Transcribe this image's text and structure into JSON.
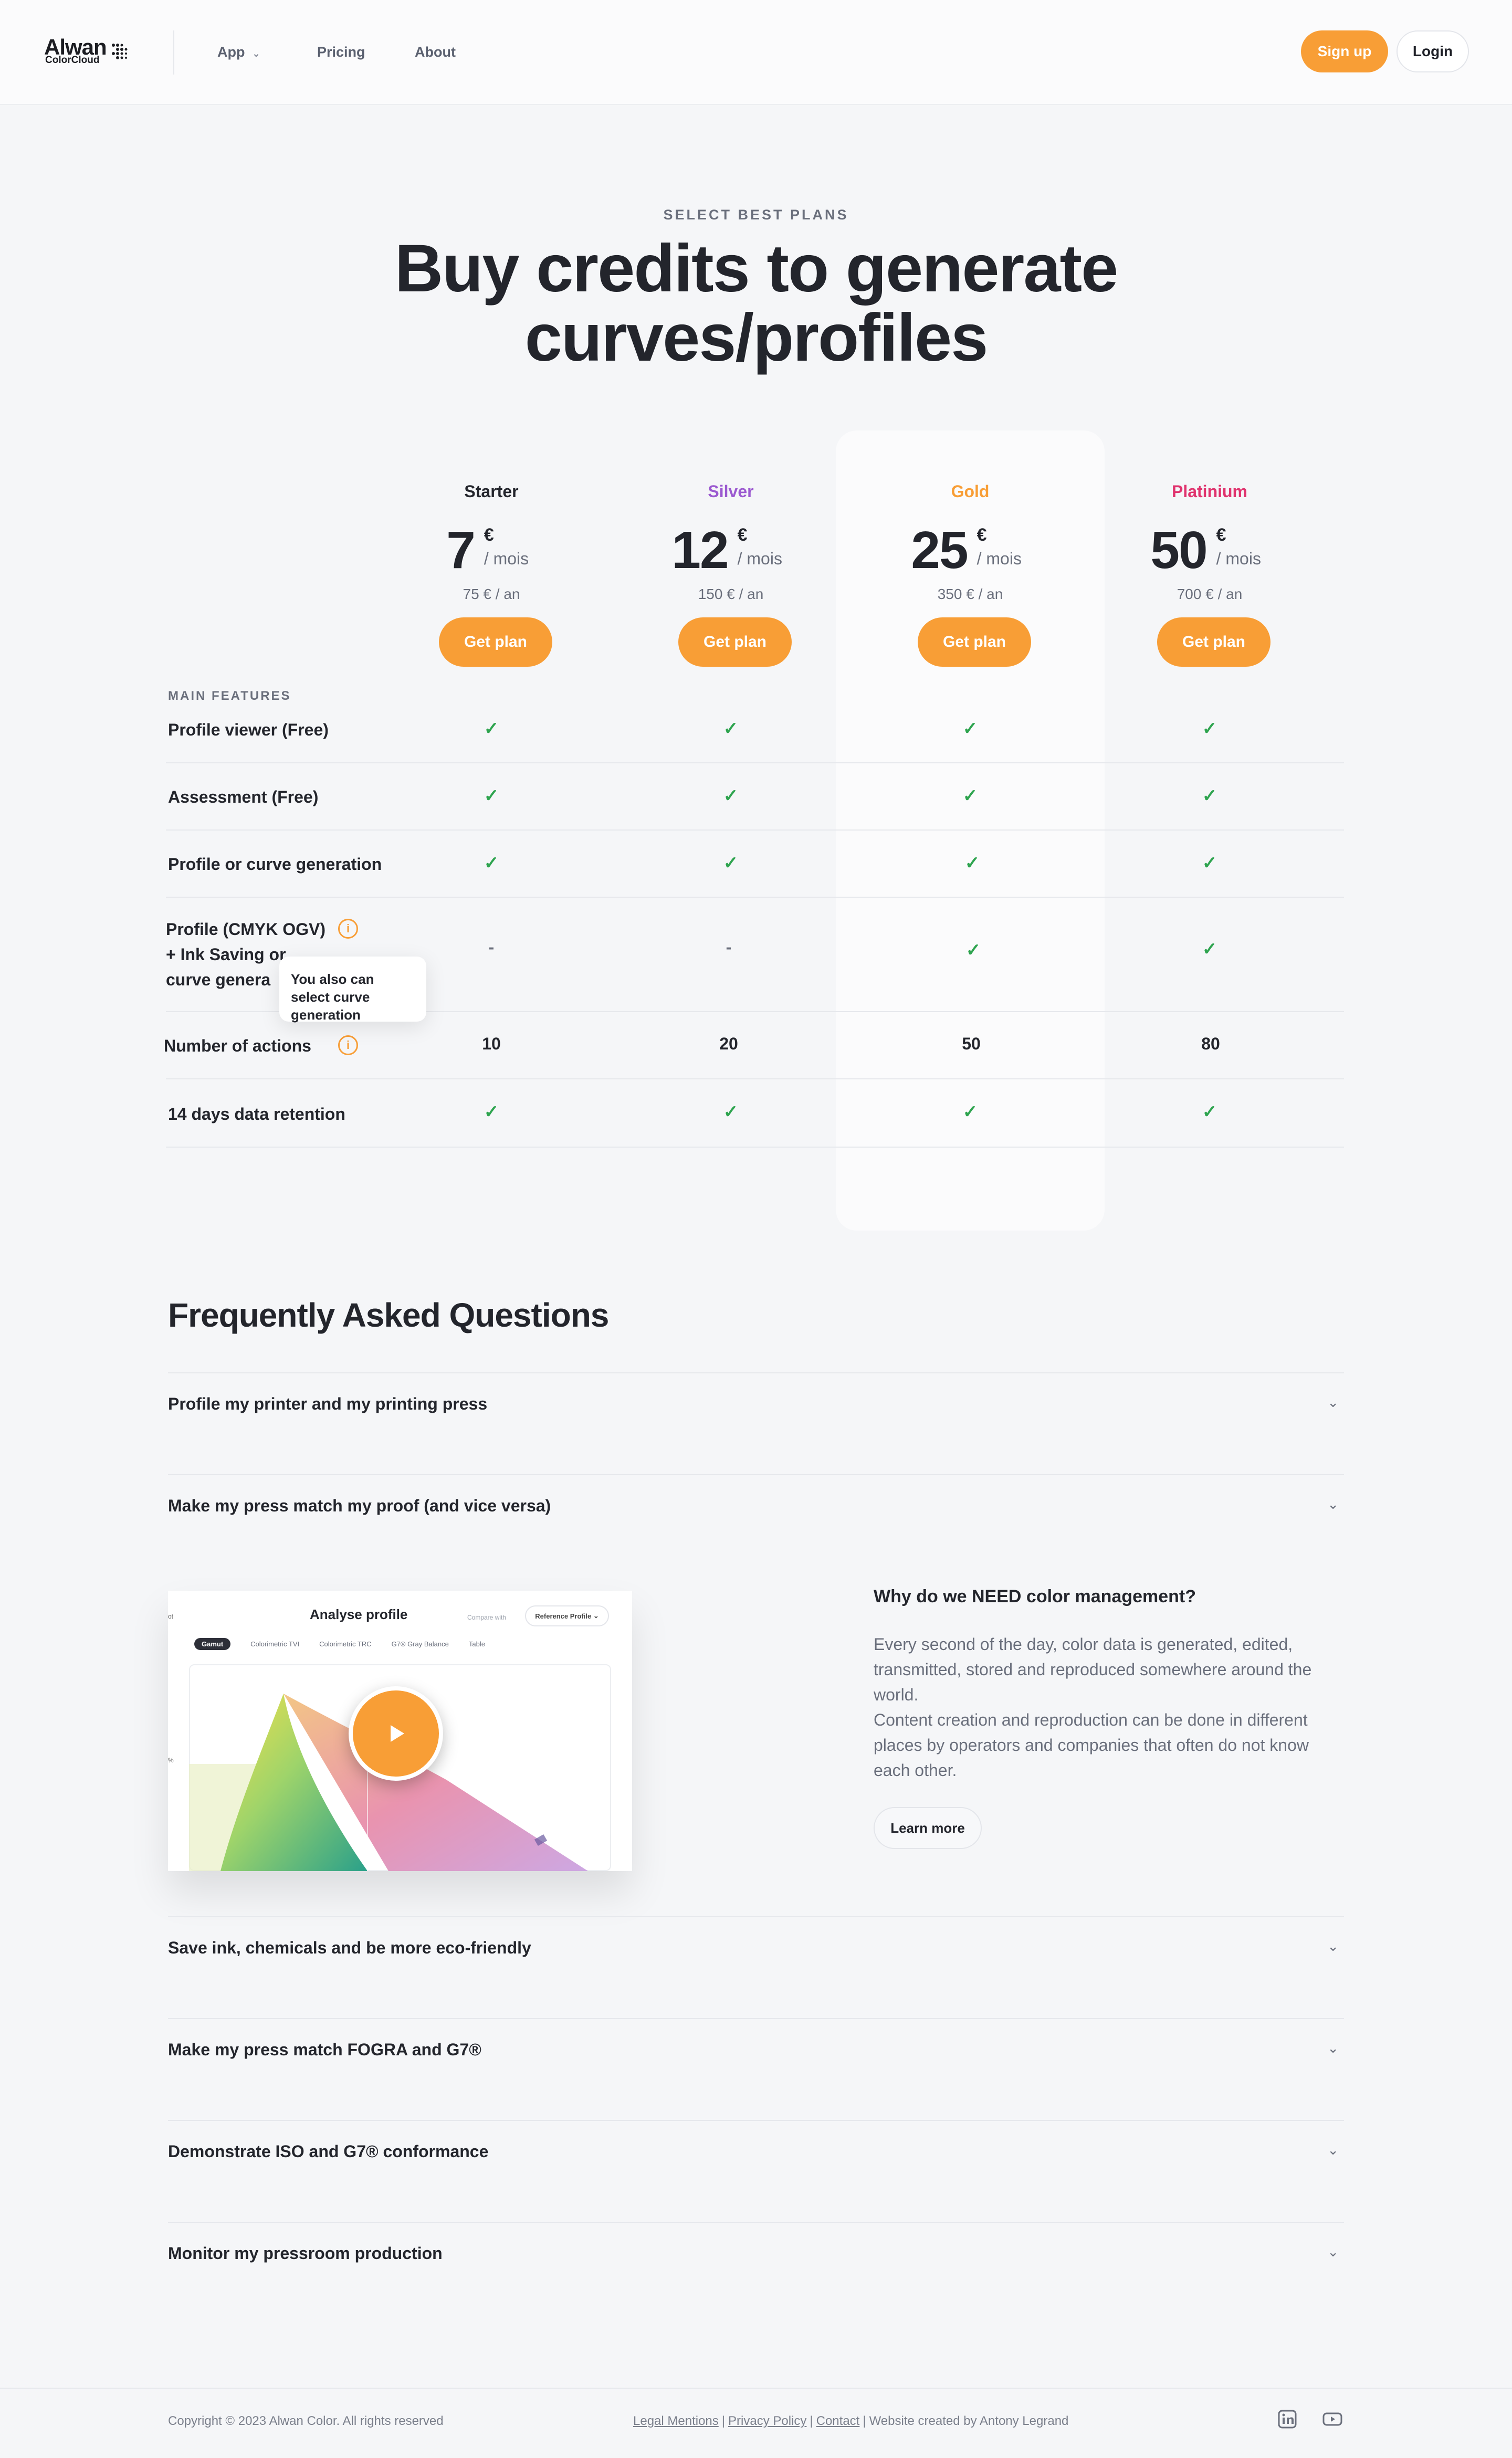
{
  "header": {
    "logo_top": "Alwan",
    "logo_bottom": "ColorCloud",
    "nav": {
      "app": "App",
      "pricing": "Pricing",
      "about": "About"
    },
    "signup": "Sign up",
    "login": "Login"
  },
  "hero": {
    "eyebrow": "SELECT BEST PLANS",
    "title_line1": "Buy credits to generate",
    "title_line2": "curves/profiles"
  },
  "plans": [
    {
      "name": "Starter",
      "color": "#23252c",
      "amount": "7",
      "currency": "€",
      "period": "/ mois",
      "yearly": "75 € / an",
      "cta": "Get plan"
    },
    {
      "name": "Silver",
      "color": "#9b59d0",
      "amount": "12",
      "currency": "€",
      "period": "/ mois",
      "yearly": "150 € / an",
      "cta": "Get plan"
    },
    {
      "name": "Gold",
      "color": "#f89e36",
      "amount": "25",
      "currency": "€",
      "period": "/ mois",
      "yearly": "350 € / an",
      "cta": "Get plan"
    },
    {
      "name": "Platinium",
      "color": "#e0336e",
      "amount": "50",
      "currency": "€",
      "period": "/ mois",
      "yearly": "700 € / an",
      "cta": "Get plan"
    }
  ],
  "features": {
    "label": "MAIN FEATURES",
    "rows": [
      {
        "name": "Profile viewer (Free)",
        "values": [
          "✓",
          "✓",
          "✓",
          "✓"
        ]
      },
      {
        "name": "Assessment (Free)",
        "values": [
          "✓",
          "✓",
          "✓",
          "✓"
        ]
      },
      {
        "name": "Profile or curve generation",
        "values": [
          "✓",
          "✓",
          "✓",
          "✓"
        ]
      },
      {
        "name_line1": "Profile (CMYK OGV)",
        "name_line2": "+ Ink Saving or",
        "name_line3": "curve genera",
        "values": [
          "-",
          "-",
          "✓",
          "✓"
        ]
      },
      {
        "name": "Number of actions",
        "values": [
          "10",
          "20",
          "50",
          "80"
        ]
      },
      {
        "name": "14 days data retention",
        "values": [
          "✓",
          "✓",
          "✓",
          "✓"
        ]
      }
    ],
    "info_icon": "i",
    "tooltip": "You also can select curve generation"
  },
  "faq": {
    "title": "Frequently Asked Questions",
    "items": [
      "Profile my printer and my printing press",
      "Make my press match my proof (and vice versa)",
      "Save ink, chemicals and be more eco-friendly",
      "Make my press match FOGRA and G7®",
      "Demonstrate ISO and G7® conformance",
      "Monitor my pressroom production"
    ],
    "expanded": {
      "video": {
        "title": "Analyse profile",
        "compare": "Compare with",
        "select": "Reference Profile",
        "tabs": [
          "Gamut",
          "Colorimetric TVI",
          "Colorimetric TRC",
          "G7® Gray Balance",
          "Table"
        ],
        "axis_top": "ot",
        "axis_mid": "%"
      },
      "why_title": "Why do we NEED color management?",
      "why_p1": "Every second of the day, color data is generated, edited, transmitted, stored and reproduced somewhere around the world.",
      "why_p2": "Content creation and reproduction can be done in different places by operators and companies that often do not know each other.",
      "learn_more": "Learn more"
    }
  },
  "footer": {
    "copyright": "Copyright © 2023 Alwan Color. All rights reserved",
    "legal": "Legal Mentions",
    "privacy": "Privacy Policy",
    "contact": "Contact",
    "credit": "Website created by Antony Legrand",
    "sep": "|"
  },
  "icons": [
    "chevron-down-icon",
    "check-icon",
    "info-icon",
    "play-icon",
    "linkedin-icon",
    "youtube-icon"
  ]
}
